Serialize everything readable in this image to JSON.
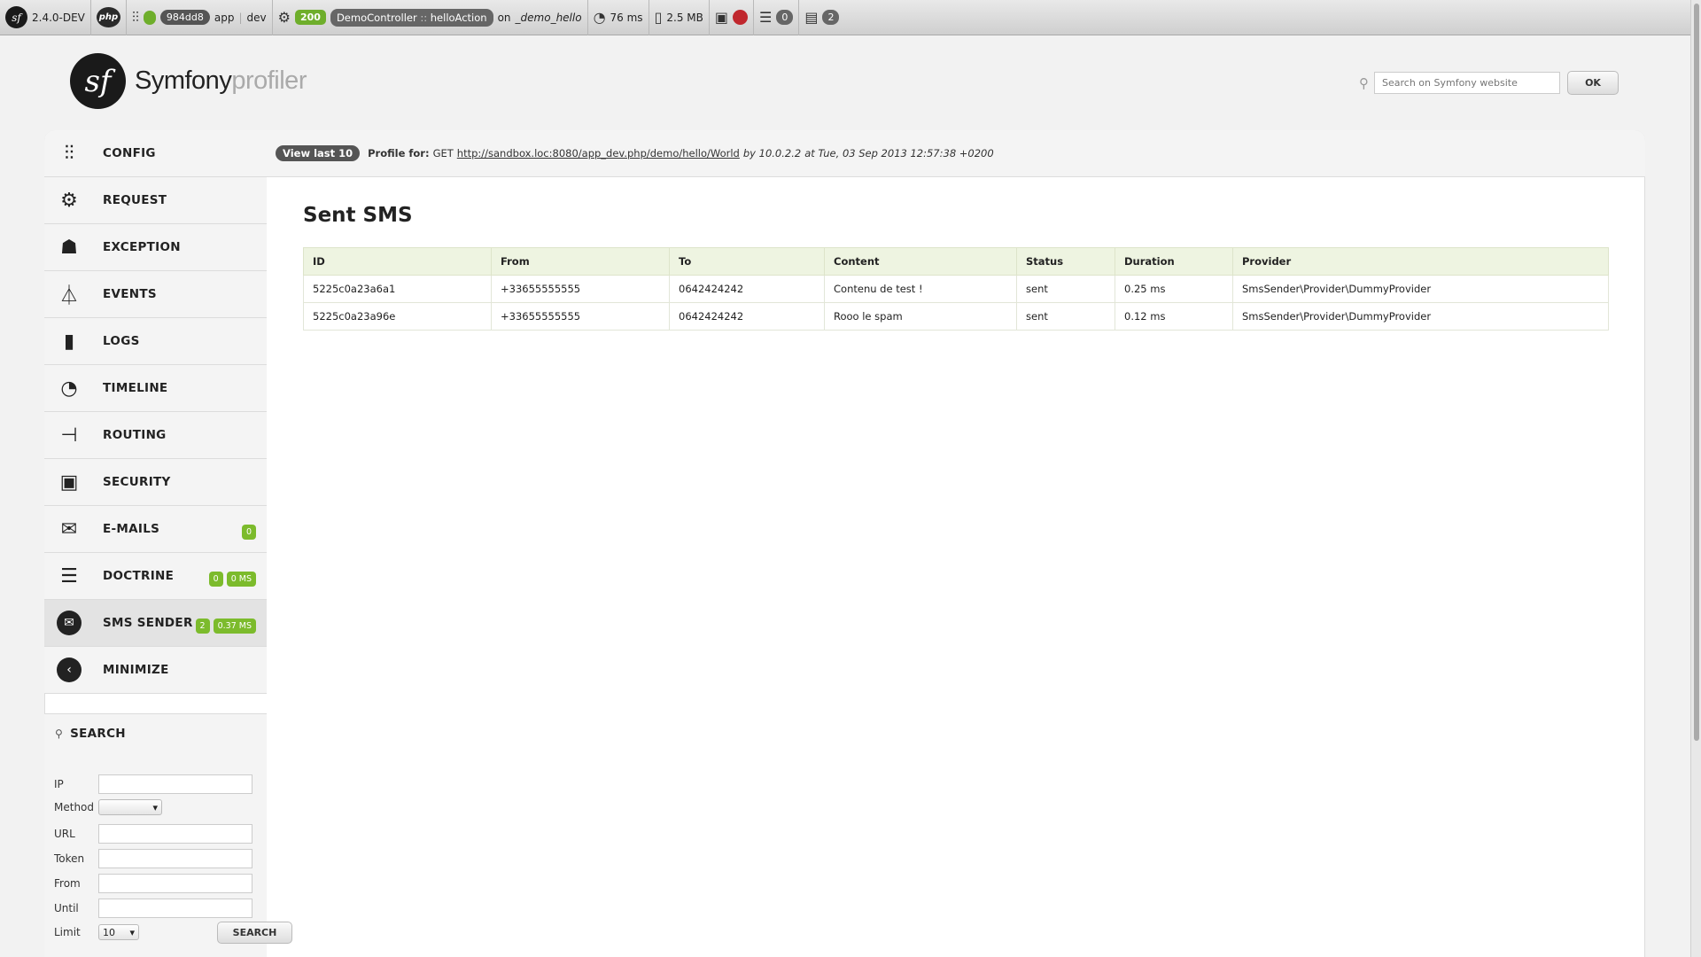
{
  "toolbar": {
    "sf_glyph": "sf",
    "version": "2.4.0-DEV",
    "php_glyph": "php",
    "token": "984dd8",
    "app_name": "app",
    "env": "dev",
    "status_code": "200",
    "controller_class": "DemoController",
    "controller_sep": " :: ",
    "controller_action": "helloAction",
    "on_text": "on",
    "route": "_demo_hello",
    "time": "76 ms",
    "memory": "2.5 MB",
    "db_count": "0",
    "sms_count": "2"
  },
  "header": {
    "logo_glyph": "sf",
    "logo_part1": "Symfony",
    "logo_part2": "profiler",
    "search_placeholder": "Search on Symfony website",
    "ok_label": "OK"
  },
  "nav": {
    "items": [
      {
        "label": "CONFIG",
        "icon": "config-icon"
      },
      {
        "label": "REQUEST",
        "icon": "gears-icon"
      },
      {
        "label": "EXCEPTION",
        "icon": "ghost-icon"
      },
      {
        "label": "EVENTS",
        "icon": "antenna-icon"
      },
      {
        "label": "LOGS",
        "icon": "logbook-icon"
      },
      {
        "label": "TIMELINE",
        "icon": "stopwatch-icon"
      },
      {
        "label": "ROUTING",
        "icon": "signpost-icon"
      },
      {
        "label": "SECURITY",
        "icon": "id-card-icon"
      },
      {
        "label": "E-MAILS",
        "icon": "envelope-icon",
        "badge": "0"
      },
      {
        "label": "DOCTRINE",
        "icon": "database-icon",
        "badge": "0",
        "badge2": "0 MS"
      },
      {
        "label": "SMS SENDER",
        "icon": "sms-icon",
        "badge": "2",
        "badge2": "0.37 MS"
      },
      {
        "label": "MINIMIZE",
        "icon": "chevron-left-icon"
      }
    ]
  },
  "search": {
    "title": "SEARCH",
    "ip_label": "IP",
    "method_label": "Method",
    "url_label": "URL",
    "token_label": "Token",
    "from_label": "From",
    "until_label": "Until",
    "limit_label": "Limit",
    "limit_value": "10",
    "button_label": "SEARCH"
  },
  "profile": {
    "view_last": "View last 10",
    "profile_for": "Profile for:",
    "method": "GET",
    "url": "http://sandbox.loc:8080/app_dev.php/demo/hello/World",
    "by_ip": "by 10.0.2.2",
    "at_date": "at Tue, 03 Sep 2013 12:57:38 +0200"
  },
  "content": {
    "title": "Sent SMS",
    "columns": [
      "ID",
      "From",
      "To",
      "Content",
      "Status",
      "Duration",
      "Provider"
    ],
    "rows": [
      [
        "5225c0a23a6a1",
        "+33655555555",
        "0642424242",
        "Contenu de test !",
        "sent",
        "0.25 ms",
        "SmsSender\\Provider\\DummyProvider"
      ],
      [
        "5225c0a23a96e",
        "+33655555555",
        "0642424242",
        "Rooo le spam",
        "sent",
        "0.12 ms",
        "SmsSender\\Provider\\DummyProvider"
      ]
    ]
  },
  "colors": {
    "accent_green": "#7cbb2c",
    "error_red": "#c0272d",
    "table_header": "#eef4e1"
  }
}
